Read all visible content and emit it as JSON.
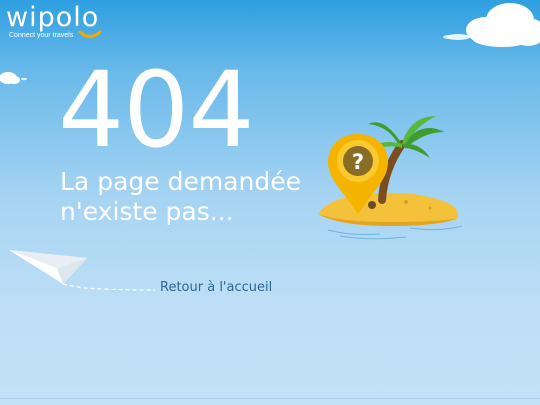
{
  "brand": {
    "name": "wipolo",
    "tagline": "Connect your travels",
    "accent_color": "#f2a900"
  },
  "error": {
    "code": "404",
    "message_line1": "La page demandée",
    "message_line2": "n'existe pas..."
  },
  "navigation": {
    "home_link_label": "Retour à l'accueil"
  },
  "illustration": {
    "marker_symbol": "?",
    "icons": [
      "map-pin-icon",
      "island-icon",
      "palm-tree-icon",
      "paper-plane-icon",
      "cloud-icon"
    ]
  },
  "colors": {
    "sky_top": "#2e9fe0",
    "sky_bottom": "#c4e2f7",
    "link": "#2a6890",
    "sand": "#f3c23a",
    "marker": "#f5b400",
    "palm_leaf": "#3f9c2e"
  }
}
